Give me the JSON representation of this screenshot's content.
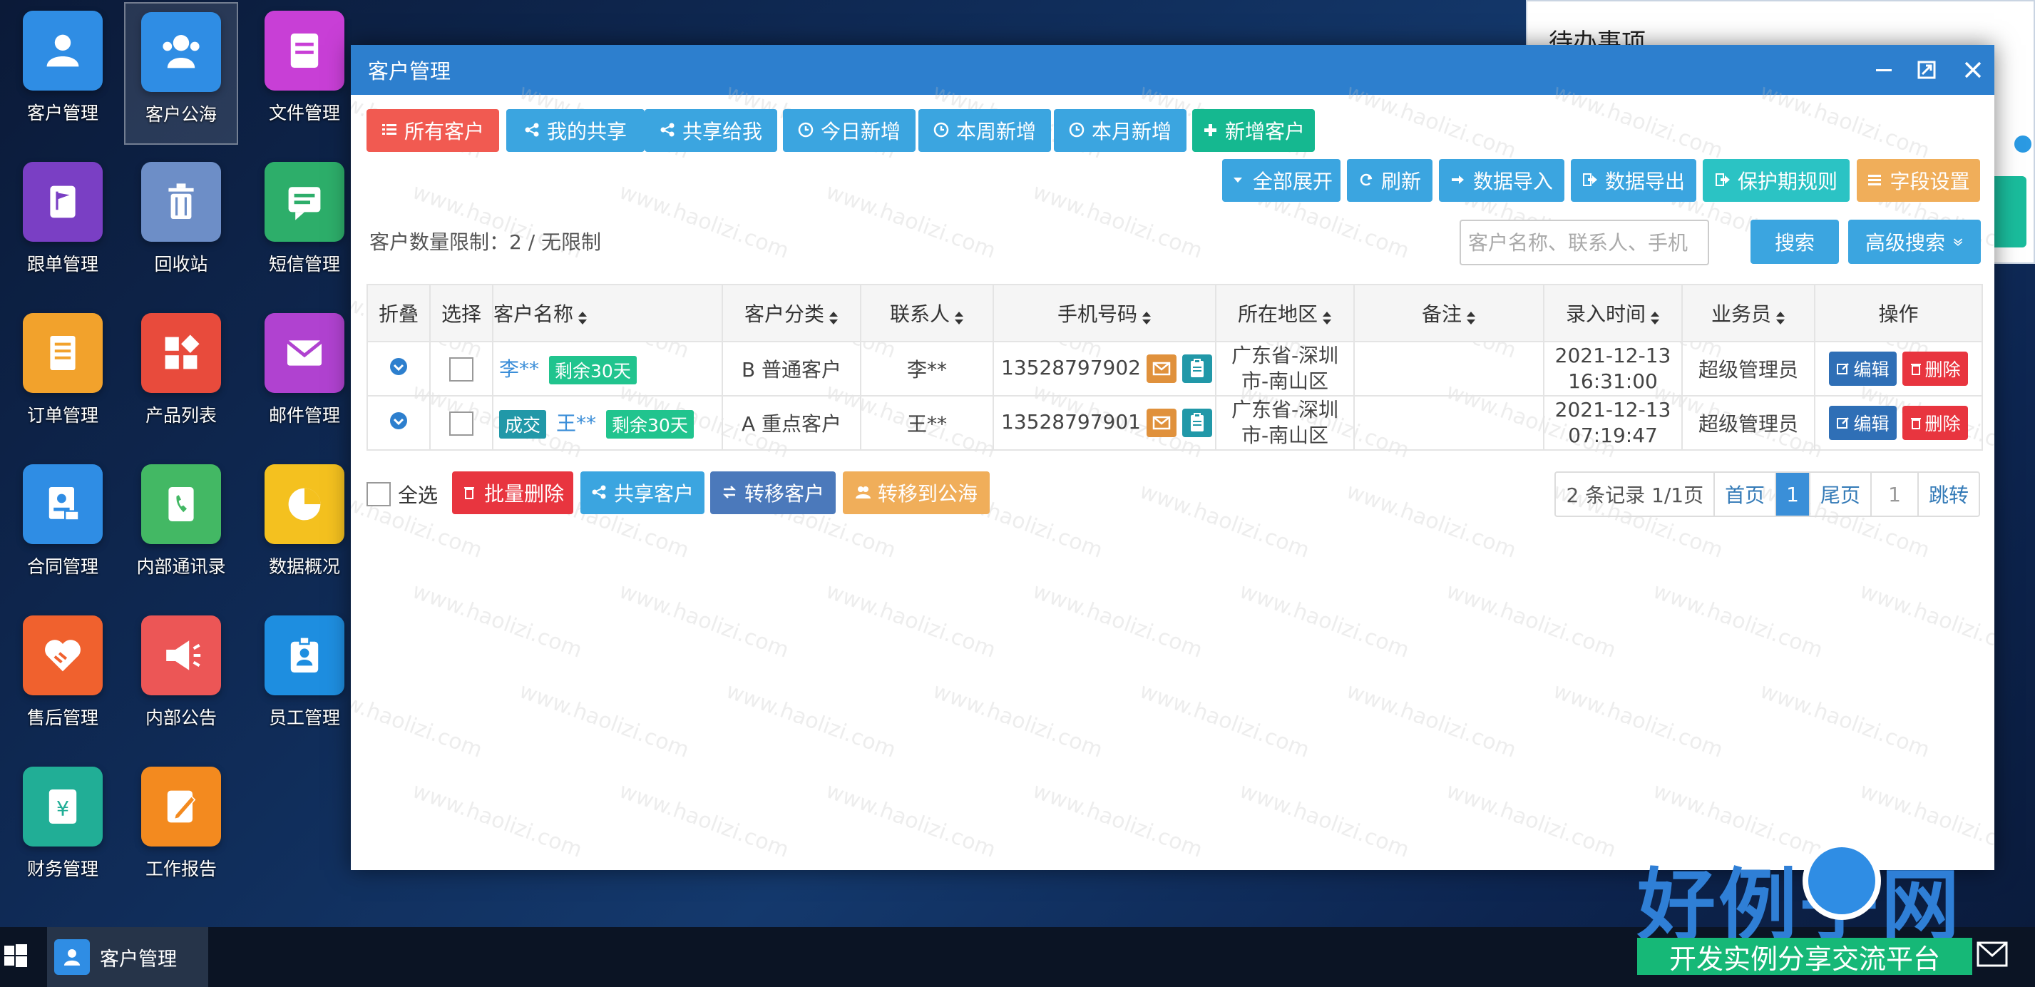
{
  "desktop": {
    "icons": [
      {
        "label": "客户管理",
        "color": "#2f8de4",
        "icon": "users-icon"
      },
      {
        "label": "客户公海",
        "color": "#2f8de4",
        "icon": "user-group-icon"
      },
      {
        "label": "文件管理",
        "color": "#c83fd6",
        "icon": "file-icon"
      },
      {
        "label": "跟单管理",
        "color": "#7a3fc4",
        "icon": "flag-icon"
      },
      {
        "label": "回收站",
        "color": "#6d8ec7",
        "icon": "trash-icon"
      },
      {
        "label": "短信管理",
        "color": "#2dae6a",
        "icon": "message-icon"
      },
      {
        "label": "订单管理",
        "color": "#f2a22c",
        "icon": "list-icon"
      },
      {
        "label": "产品列表",
        "color": "#e84b3c",
        "icon": "grid-icon"
      },
      {
        "label": "邮件管理",
        "color": "#b042d0",
        "icon": "mail-icon"
      },
      {
        "label": "合同管理",
        "color": "#2f8de4",
        "icon": "contract-icon"
      },
      {
        "label": "内部通讯录",
        "color": "#43b864",
        "icon": "phonebook-icon"
      },
      {
        "label": "数据概况",
        "color": "#f4c11f",
        "icon": "piechart-icon"
      },
      {
        "label": "售后管理",
        "color": "#f0612e",
        "icon": "handshake-icon"
      },
      {
        "label": "内部公告",
        "color": "#ec5656",
        "icon": "megaphone-icon"
      },
      {
        "label": "员工管理",
        "color": "#1e8ee0",
        "icon": "badge-icon"
      },
      {
        "label": "财务管理",
        "color": "#21ae96",
        "icon": "yen-icon"
      },
      {
        "label": "工作报告",
        "color": "#f38a1f",
        "icon": "pen-icon"
      }
    ]
  },
  "todo": {
    "title": "待办事项"
  },
  "window": {
    "title": "客户管理",
    "filter_buttons": [
      {
        "label": "所有客户",
        "color": "red",
        "icon": "list-icon"
      },
      {
        "label": "我的共享",
        "color": "blue",
        "icon": "share-icon"
      },
      {
        "label": "共享给我",
        "color": "blue",
        "icon": "share-icon"
      },
      {
        "label": "今日新增",
        "color": "blue",
        "icon": "clock-icon"
      },
      {
        "label": "本周新增",
        "color": "blue",
        "icon": "clock-icon"
      },
      {
        "label": "本月新增",
        "color": "blue",
        "icon": "clock-icon"
      },
      {
        "label": "新增客户",
        "color": "green",
        "icon": "plus-icon"
      }
    ],
    "action_buttons": [
      {
        "label": "全部展开",
        "color": "blue",
        "icon": "caret-down-icon"
      },
      {
        "label": "刷新",
        "color": "blue",
        "icon": "refresh-icon"
      },
      {
        "label": "数据导入",
        "color": "blue",
        "icon": "import-icon"
      },
      {
        "label": "数据导出",
        "color": "blue",
        "icon": "export-icon"
      },
      {
        "label": "保护期规则",
        "color": "teal",
        "icon": "export-icon"
      },
      {
        "label": "字段设置",
        "color": "orange",
        "icon": "bars-icon"
      }
    ],
    "limit_text": "客户数量限制：2 / 无限制",
    "search_placeholder": "客户名称、联系人、手机",
    "search_button": "搜索",
    "advanced_search": "高级搜索",
    "columns": [
      "折叠",
      "选择",
      "客户名称",
      "客户分类",
      "联系人",
      "手机号码",
      "所在地区",
      "备注",
      "录入时间",
      "业务员",
      "操作"
    ],
    "rows": [
      {
        "status": "",
        "name": "李**",
        "remain": "剩余30天",
        "category": "B 普通客户",
        "contact": "李**",
        "phone": "13528797902",
        "region_line1": "广东省-深圳",
        "region_line2": "市-南山区",
        "note": "",
        "date": "2021-12-13",
        "time": "16:31:00",
        "salesman": "超级管理员",
        "edit": "编辑",
        "delete": "删除"
      },
      {
        "status": "成交",
        "name": "王**",
        "remain": "剩余30天",
        "category": "A 重点客户",
        "contact": "王**",
        "phone": "13528797901",
        "region_line1": "广东省-深圳",
        "region_line2": "市-南山区",
        "note": "",
        "date": "2021-12-13",
        "time": "07:19:47",
        "salesman": "超级管理员",
        "edit": "编辑",
        "delete": "删除"
      }
    ],
    "select_all": "全选",
    "bottom_buttons": [
      {
        "label": "批量删除",
        "color": "#e8353f",
        "icon": "trash-icon"
      },
      {
        "label": "共享客户",
        "color": "#3ba5e0",
        "icon": "share-icon"
      },
      {
        "label": "转移客户",
        "color": "#4b79bb",
        "icon": "transfer-icon"
      },
      {
        "label": "转移到公海",
        "color": "#f0ae5a",
        "icon": "users-icon"
      }
    ],
    "pager": {
      "summary": "2 条记录 1/1页",
      "first": "首页",
      "current": "1",
      "last": "尾页",
      "input": "1",
      "jump": "跳转"
    },
    "watermark": "www.haolizi.com"
  },
  "taskbar": {
    "item": "客户管理"
  },
  "brand": {
    "title": "好例子网",
    "subtitle": "开发实例分享交流平台"
  }
}
